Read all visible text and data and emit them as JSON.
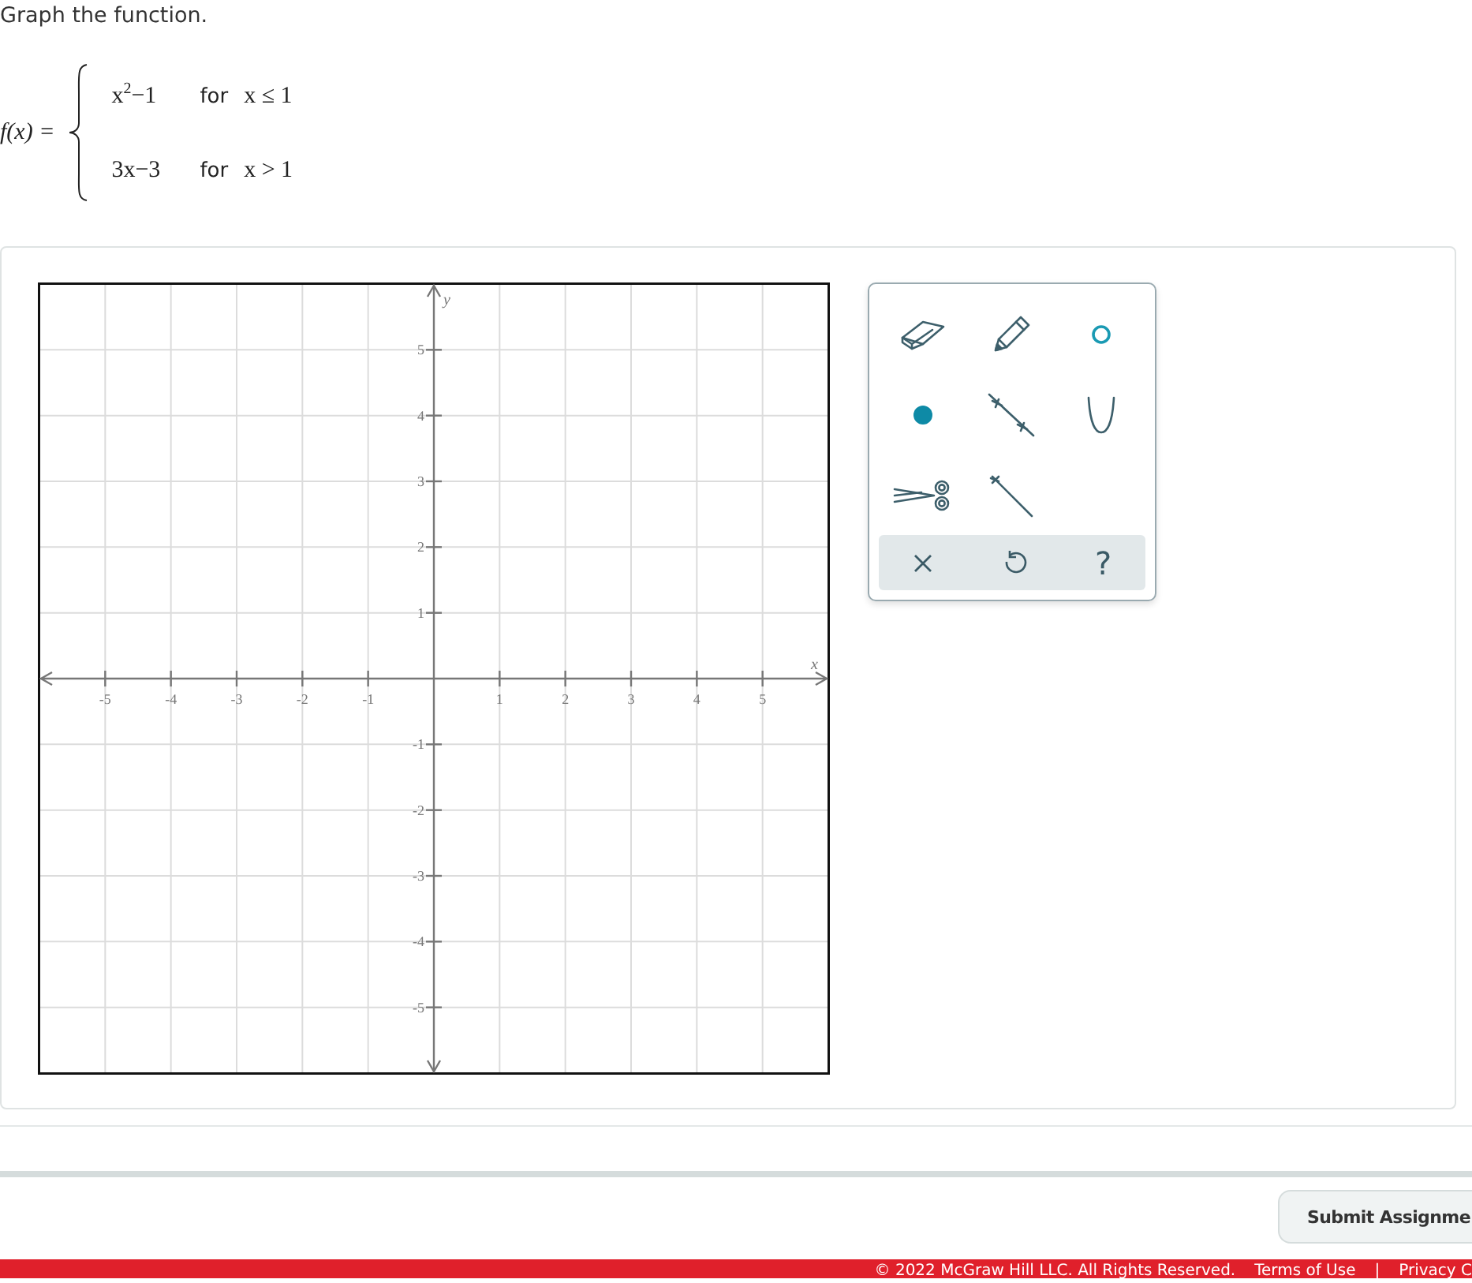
{
  "prompt": "Graph the function.",
  "function": {
    "name": "f(x) =",
    "pieces": [
      {
        "expression": "x$^{2}$−1",
        "condition_word": "for",
        "condition": "x ≤ 1"
      },
      {
        "expression": "3x−3",
        "condition_word": "for",
        "condition": "x > 1"
      }
    ]
  },
  "graph": {
    "chart_data": {
      "type": "line",
      "grid": true,
      "xlabel": "x",
      "ylabel": "y",
      "xlim": [
        -6,
        6
      ],
      "ylim": [
        -6,
        6
      ],
      "xticks": [
        -5,
        -4,
        -3,
        -2,
        -1,
        1,
        2,
        3,
        4,
        5
      ],
      "yticks": [
        -5,
        -4,
        -3,
        -2,
        -1,
        1,
        2,
        3,
        4,
        5
      ]
    }
  },
  "tools": [
    {
      "kind": "eraser",
      "selected": false
    },
    {
      "kind": "pencil",
      "selected": false
    },
    {
      "kind": "open-point",
      "selected": false
    },
    {
      "kind": "closed-point",
      "selected": false
    },
    {
      "kind": "line",
      "selected": false
    },
    {
      "kind": "parabola",
      "selected": false
    },
    {
      "kind": "scissors",
      "selected": false
    },
    {
      "kind": "ray",
      "selected": false
    }
  ],
  "actions": [
    {
      "kind": "clear"
    },
    {
      "kind": "undo"
    },
    {
      "kind": "help",
      "label": "?"
    }
  ],
  "submit_button": "Submit Assignme",
  "footer": [
    "© 2022 McGraw Hill LLC. All Rights Reserved.",
    "Terms of Use",
    "|",
    "Privacy C"
  ]
}
